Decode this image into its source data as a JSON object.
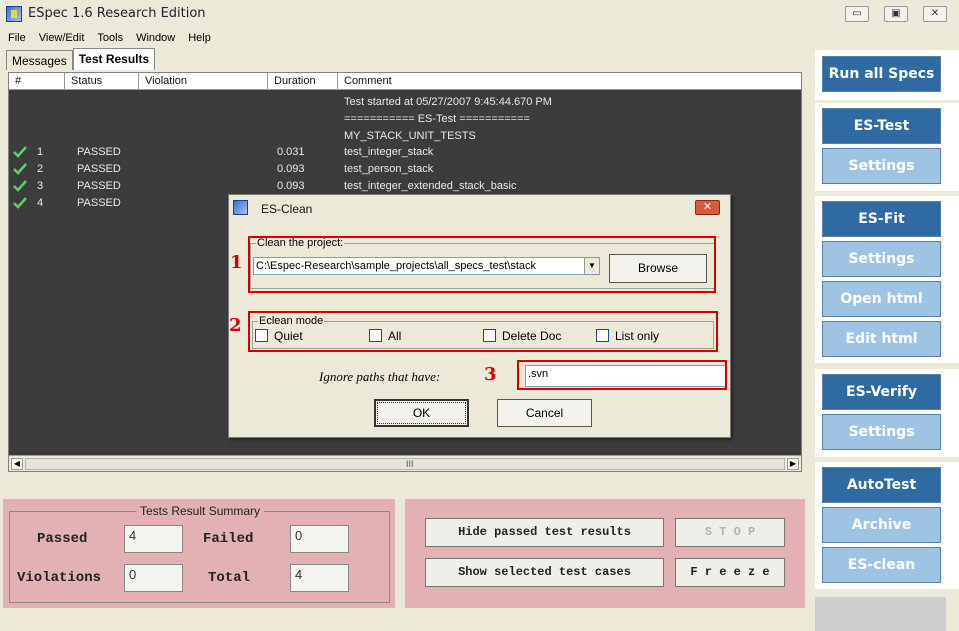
{
  "window": {
    "title": "ESpec 1.6 Research Edition",
    "minimize": "▭",
    "maximize": "▣",
    "close": "✕"
  },
  "menu": [
    "File",
    "View/Edit",
    "Tools",
    "Window",
    "Help"
  ],
  "tabs": [
    {
      "label": "Messages",
      "active": false
    },
    {
      "label": "Test Results",
      "active": true
    }
  ],
  "results": {
    "columns": [
      "#",
      "Status",
      "Violation",
      "Duration",
      "Comment"
    ],
    "log_lines": [
      "Test started at 05/27/2007 9:45:44.670 PM",
      "=========== ES-Test ===========",
      "MY_STACK_UNIT_TESTS"
    ],
    "rows": [
      {
        "num": "1",
        "status": "PASSED",
        "duration": "0.031",
        "comment": "test_integer_stack"
      },
      {
        "num": "2",
        "status": "PASSED",
        "duration": "0.093",
        "comment": "test_person_stack"
      },
      {
        "num": "3",
        "status": "PASSED",
        "duration": "0.093",
        "comment": "test_integer_extended_stack_basic"
      },
      {
        "num": "4",
        "status": "PASSED",
        "duration": "",
        "comment": ""
      }
    ],
    "scroll_left": "◀",
    "scroll_right": "▶",
    "scroll_grip": "III"
  },
  "sidebar": {
    "run_all": "Run all Specs",
    "es_test": "ES-Test",
    "settings": "Settings",
    "es_fit": "ES-Fit",
    "open_html": "Open html",
    "edit_html": "Edit html",
    "es_verify": "ES-Verify",
    "autotest": "AutoTest",
    "archive": "Archive",
    "es_clean": "ES-clean"
  },
  "summary": {
    "legend": "Tests Result Summary",
    "passed_label": "Passed",
    "passed_value": "4",
    "failed_label": "Failed",
    "failed_value": "0",
    "violations_label": "Violations",
    "violations_value": "0",
    "total_label": "Total",
    "total_value": "4"
  },
  "actions": {
    "hide_passed": "Hide passed test results",
    "stop": "S T O P",
    "show_selected": "Show selected test cases",
    "freeze": "F r e e z e"
  },
  "dialog": {
    "title": "ES-Clean",
    "close": "✕",
    "clean_legend": "Clean the project:",
    "project_path": "C:\\Espec-Research\\sample_projects\\all_specs_test\\stack",
    "combo_arrow": "▼",
    "browse": "Browse",
    "mode_legend": "Eclean mode",
    "modes": [
      "Quiet",
      "All",
      "Delete Doc",
      "List only"
    ],
    "ignore_label": "Ignore paths that have:",
    "ignore_value": ".svn",
    "ok": "OK",
    "cancel": "Cancel"
  },
  "annotations": [
    "1",
    "2",
    "3"
  ],
  "colors": {
    "sidebar_dark": "#2f6aa3",
    "sidebar_light": "#9fc3e3",
    "panel_pink": "#e3b1b4",
    "annotation_red": "#d60000",
    "results_bg": "#3c3c3c"
  }
}
